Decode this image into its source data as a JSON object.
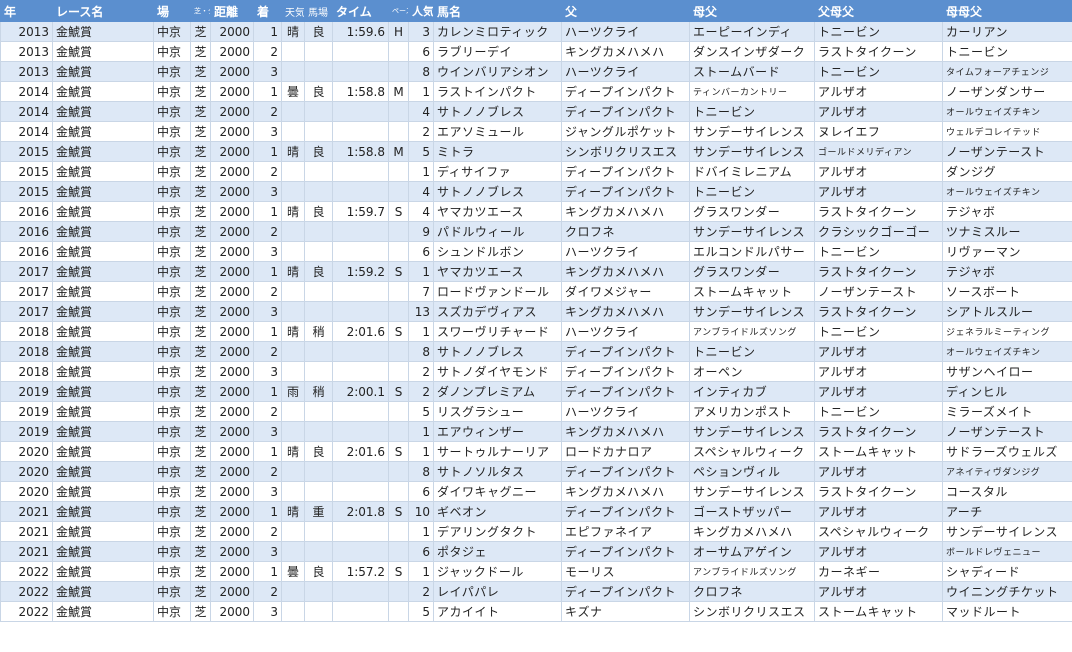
{
  "headers": [
    "年",
    "レース名",
    "場",
    "芝・ダ",
    "距離",
    "着",
    "天気",
    "馬場",
    "タイム",
    "ペース",
    "人気",
    "馬名",
    "父",
    "母父",
    "父母父",
    "母母父"
  ],
  "rows": [
    [
      "2013",
      "金鯱賞",
      "中京",
      "芝",
      "2000",
      "1",
      "晴",
      "良",
      "1:59.6",
      "H",
      "3",
      "カレンミロティック",
      "ハーツクライ",
      "エーピーインディ",
      "トニービン",
      "カーリアン"
    ],
    [
      "2013",
      "金鯱賞",
      "中京",
      "芝",
      "2000",
      "2",
      "",
      "",
      "",
      "",
      "6",
      "ラブリーデイ",
      "キングカメハメハ",
      "ダンスインザダーク",
      "ラストタイクーン",
      "トニービン"
    ],
    [
      "2013",
      "金鯱賞",
      "中京",
      "芝",
      "2000",
      "3",
      "",
      "",
      "",
      "",
      "8",
      "ウインバリアシオン",
      "ハーツクライ",
      "ストームバード",
      "トニービン",
      "タイムフォーアチェンジ"
    ],
    [
      "2014",
      "金鯱賞",
      "中京",
      "芝",
      "2000",
      "1",
      "曇",
      "良",
      "1:58.8",
      "M",
      "1",
      "ラストインパクト",
      "ディープインパクト",
      "ティンバーカントリー",
      "アルザオ",
      "ノーザンダンサー"
    ],
    [
      "2014",
      "金鯱賞",
      "中京",
      "芝",
      "2000",
      "2",
      "",
      "",
      "",
      "",
      "4",
      "サトノノブレス",
      "ディープインパクト",
      "トニービン",
      "アルザオ",
      "オールウェイズチキン"
    ],
    [
      "2014",
      "金鯱賞",
      "中京",
      "芝",
      "2000",
      "3",
      "",
      "",
      "",
      "",
      "2",
      "エアソミュール",
      "ジャングルポケット",
      "サンデーサイレンス",
      "ヌレイエフ",
      "ウェルデコレイテッド"
    ],
    [
      "2015",
      "金鯱賞",
      "中京",
      "芝",
      "2000",
      "1",
      "晴",
      "良",
      "1:58.8",
      "M",
      "5",
      "ミトラ",
      "シンボリクリスエス",
      "サンデーサイレンス",
      "ゴールドメリディアン",
      "ノーザンテースト"
    ],
    [
      "2015",
      "金鯱賞",
      "中京",
      "芝",
      "2000",
      "2",
      "",
      "",
      "",
      "",
      "1",
      "ディサイファ",
      "ディープインパクト",
      "ドバイミレニアム",
      "アルザオ",
      "ダンジグ"
    ],
    [
      "2015",
      "金鯱賞",
      "中京",
      "芝",
      "2000",
      "3",
      "",
      "",
      "",
      "",
      "4",
      "サトノノブレス",
      "ディープインパクト",
      "トニービン",
      "アルザオ",
      "オールウェイズチキン"
    ],
    [
      "2016",
      "金鯱賞",
      "中京",
      "芝",
      "2000",
      "1",
      "晴",
      "良",
      "1:59.7",
      "S",
      "4",
      "ヤマカツエース",
      "キングカメハメハ",
      "グラスワンダー",
      "ラストタイクーン",
      "テジャボ"
    ],
    [
      "2016",
      "金鯱賞",
      "中京",
      "芝",
      "2000",
      "2",
      "",
      "",
      "",
      "",
      "9",
      "パドルウィール",
      "クロフネ",
      "サンデーサイレンス",
      "クラシックゴーゴー",
      "ツナミスルー"
    ],
    [
      "2016",
      "金鯱賞",
      "中京",
      "芝",
      "2000",
      "3",
      "",
      "",
      "",
      "",
      "6",
      "シュンドルボン",
      "ハーツクライ",
      "エルコンドルパサー",
      "トニービン",
      "リヴァーマン"
    ],
    [
      "2017",
      "金鯱賞",
      "中京",
      "芝",
      "2000",
      "1",
      "晴",
      "良",
      "1:59.2",
      "S",
      "1",
      "ヤマカツエース",
      "キングカメハメハ",
      "グラスワンダー",
      "ラストタイクーン",
      "テジャボ"
    ],
    [
      "2017",
      "金鯱賞",
      "中京",
      "芝",
      "2000",
      "2",
      "",
      "",
      "",
      "",
      "7",
      "ロードヴァンドール",
      "ダイワメジャー",
      "ストームキャット",
      "ノーザンテースト",
      "ソースボート"
    ],
    [
      "2017",
      "金鯱賞",
      "中京",
      "芝",
      "2000",
      "3",
      "",
      "",
      "",
      "",
      "13",
      "スズカデヴィアス",
      "キングカメハメハ",
      "サンデーサイレンス",
      "ラストタイクーン",
      "シアトルスルー"
    ],
    [
      "2018",
      "金鯱賞",
      "中京",
      "芝",
      "2000",
      "1",
      "晴",
      "稍",
      "2:01.6",
      "S",
      "1",
      "スワーヴリチャード",
      "ハーツクライ",
      "アンブライドルズソング",
      "トニービン",
      "ジェネラルミーティング"
    ],
    [
      "2018",
      "金鯱賞",
      "中京",
      "芝",
      "2000",
      "2",
      "",
      "",
      "",
      "",
      "8",
      "サトノノブレス",
      "ディープインパクト",
      "トニービン",
      "アルザオ",
      "オールウェイズチキン"
    ],
    [
      "2018",
      "金鯱賞",
      "中京",
      "芝",
      "2000",
      "3",
      "",
      "",
      "",
      "",
      "2",
      "サトノダイヤモンド",
      "ディープインパクト",
      "オーペン",
      "アルザオ",
      "サザンヘイロー"
    ],
    [
      "2019",
      "金鯱賞",
      "中京",
      "芝",
      "2000",
      "1",
      "雨",
      "稍",
      "2:00.1",
      "S",
      "2",
      "ダノンプレミアム",
      "ディープインパクト",
      "インティカブ",
      "アルザオ",
      "ディンヒル"
    ],
    [
      "2019",
      "金鯱賞",
      "中京",
      "芝",
      "2000",
      "2",
      "",
      "",
      "",
      "",
      "5",
      "リスグラシュー",
      "ハーツクライ",
      "アメリカンポスト",
      "トニービン",
      "ミラーズメイト"
    ],
    [
      "2019",
      "金鯱賞",
      "中京",
      "芝",
      "2000",
      "3",
      "",
      "",
      "",
      "",
      "1",
      "エアウィンザー",
      "キングカメハメハ",
      "サンデーサイレンス",
      "ラストタイクーン",
      "ノーザンテースト"
    ],
    [
      "2020",
      "金鯱賞",
      "中京",
      "芝",
      "2000",
      "1",
      "晴",
      "良",
      "2:01.6",
      "S",
      "1",
      "サートゥルナーリア",
      "ロードカナロア",
      "スペシャルウィーク",
      "ストームキャット",
      "サドラーズウェルズ"
    ],
    [
      "2020",
      "金鯱賞",
      "中京",
      "芝",
      "2000",
      "2",
      "",
      "",
      "",
      "",
      "8",
      "サトノソルタス",
      "ディープインパクト",
      "ペションヴィル",
      "アルザオ",
      "アネイティヴダンジグ"
    ],
    [
      "2020",
      "金鯱賞",
      "中京",
      "芝",
      "2000",
      "3",
      "",
      "",
      "",
      "",
      "6",
      "ダイワキャグニー",
      "キングカメハメハ",
      "サンデーサイレンス",
      "ラストタイクーン",
      "コースタル"
    ],
    [
      "2021",
      "金鯱賞",
      "中京",
      "芝",
      "2000",
      "1",
      "晴",
      "重",
      "2:01.8",
      "S",
      "10",
      "ギベオン",
      "ディープインパクト",
      "ゴーストザッパー",
      "アルザオ",
      "アーチ"
    ],
    [
      "2021",
      "金鯱賞",
      "中京",
      "芝",
      "2000",
      "2",
      "",
      "",
      "",
      "",
      "1",
      "デアリングタクト",
      "エピファネイア",
      "キングカメハメハ",
      "スペシャルウィーク",
      "サンデーサイレンス"
    ],
    [
      "2021",
      "金鯱賞",
      "中京",
      "芝",
      "2000",
      "3",
      "",
      "",
      "",
      "",
      "6",
      "ポタジェ",
      "ディープインパクト",
      "オーサムアゲイン",
      "アルザオ",
      "ボールドレヴェニュー"
    ],
    [
      "2022",
      "金鯱賞",
      "中京",
      "芝",
      "2000",
      "1",
      "曇",
      "良",
      "1:57.2",
      "S",
      "1",
      "ジャックドール",
      "モーリス",
      "アンブライドルズソング",
      "カーネギー",
      "シャディード"
    ],
    [
      "2022",
      "金鯱賞",
      "中京",
      "芝",
      "2000",
      "2",
      "",
      "",
      "",
      "",
      "2",
      "レイパパレ",
      "ディープインパクト",
      "クロフネ",
      "アルザオ",
      "ウイニングチケット"
    ],
    [
      "2022",
      "金鯱賞",
      "中京",
      "芝",
      "2000",
      "3",
      "",
      "",
      "",
      "",
      "5",
      "アカイイト",
      "キズナ",
      "シンボリクリスエス",
      "ストームキャット",
      "マッドルート"
    ]
  ]
}
